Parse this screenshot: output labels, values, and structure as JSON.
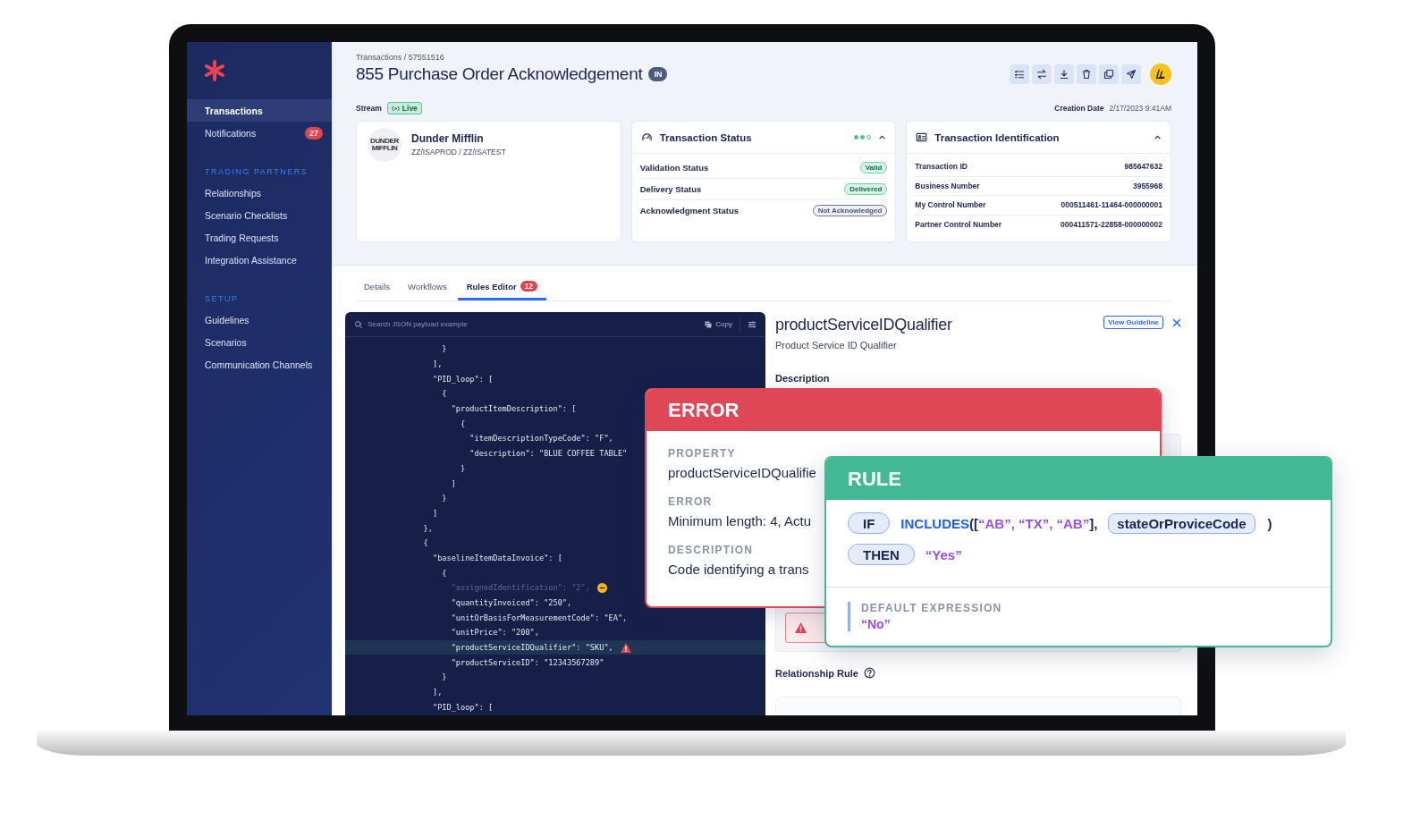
{
  "sidebar": {
    "items": [
      {
        "label": "Transactions",
        "selected": true
      },
      {
        "label": "Notifications",
        "selected": false,
        "badge": "27"
      }
    ],
    "sections": [
      {
        "title": "TRADING PARTNERS",
        "items": [
          {
            "label": "Relationships",
            "selected": false
          },
          {
            "label": "Scenario Checklists",
            "selected": false
          },
          {
            "label": "Trading Requests",
            "selected": false
          },
          {
            "label": "Integration Assistance",
            "selected": false
          }
        ]
      },
      {
        "title": "SETUP",
        "items": [
          {
            "label": "Guidelines",
            "selected": false
          },
          {
            "label": "Scenarios",
            "selected": false
          },
          {
            "label": "Communication Channels",
            "selected": false
          }
        ]
      }
    ]
  },
  "header": {
    "breadcrumb": "Transactions / 57551516",
    "title": "855 Purchase Order Acknowledgement",
    "direction_badge": "IN",
    "stream_label": "Stream",
    "stream_status": "Live",
    "creation_date_label": "Creation Date",
    "creation_date": "2/17/2023 9:41AM"
  },
  "partner_card": {
    "logo_text": "DUNDER MIFFLIN",
    "name": "Dunder Mifflin",
    "ids": "ZZ/ISAPROD / ZZ/ISATEST"
  },
  "status_card": {
    "title": "Transaction Status",
    "expanded": true,
    "progress_dots": [
      {
        "filled": true
      },
      {
        "filled": true
      },
      {
        "filled": false
      }
    ],
    "rows": [
      {
        "label": "Validation Status",
        "value": "Valid",
        "kind": "success"
      },
      {
        "label": "Delivery Status",
        "value": "Delivered",
        "kind": "success"
      },
      {
        "label": "Acknowledgment Status",
        "value": "Not Acknowledged",
        "kind": "neutral"
      }
    ]
  },
  "identification_card": {
    "title": "Transaction Identification",
    "expanded": true,
    "rows": [
      {
        "label": "Transaction ID",
        "value": "985647632"
      },
      {
        "label": "Business Number",
        "value": "3955968"
      },
      {
        "label": "My Control Number",
        "value": "000511461-11464-000000001"
      },
      {
        "label": "Partner Control Number",
        "value": "000411571-22858-000000002"
      }
    ]
  },
  "tabs": [
    {
      "label": "Details",
      "selected": false
    },
    {
      "label": "Workflows",
      "selected": false
    },
    {
      "label": "Rules Editor",
      "selected": true,
      "badge": "12"
    }
  ],
  "code_panel": {
    "search_placeholder": "Search JSON payload example",
    "copy_label": "Copy",
    "lines": [
      {
        "text": "                   }",
        "kind": "normal"
      },
      {
        "text": "                 ],",
        "kind": "normal"
      },
      {
        "text": "                 \"PID_loop\": [",
        "kind": "normal"
      },
      {
        "text": "                   {",
        "kind": "normal"
      },
      {
        "text": "                     \"productItemDescription\": [",
        "kind": "normal"
      },
      {
        "text": "                       {",
        "kind": "normal"
      },
      {
        "text": "                         \"itemDescriptionTypeCode\": \"F\",",
        "kind": "normal"
      },
      {
        "text": "                         \"description\": \"BLUE COFFEE TABLE\"",
        "kind": "normal"
      },
      {
        "text": "                       }",
        "kind": "normal"
      },
      {
        "text": "                     ]",
        "kind": "normal"
      },
      {
        "text": "                   }",
        "kind": "normal"
      },
      {
        "text": "                 ]",
        "kind": "normal"
      },
      {
        "text": "               },",
        "kind": "normal"
      },
      {
        "text": "               {",
        "kind": "normal"
      },
      {
        "text": "                 \"baselineItemDataInvoice\": [",
        "kind": "normal"
      },
      {
        "text": "                   {",
        "kind": "normal"
      },
      {
        "text": "                     \"assignedIdentification\": \"2\",",
        "kind": "removed"
      },
      {
        "text": "                     \"quantityInvoiced\": \"250\",",
        "kind": "normal"
      },
      {
        "text": "                     \"unitOrBasisForMeasurementCode\": \"EA\",",
        "kind": "normal"
      },
      {
        "text": "                     \"unitPrice\": \"200\",",
        "kind": "normal"
      },
      {
        "text": "                     \"productServiceIDQualifier\": \"SKU\",",
        "kind": "error"
      },
      {
        "text": "                     \"productServiceID\": \"12343567289\"",
        "kind": "normal"
      },
      {
        "text": "                   }",
        "kind": "normal"
      },
      {
        "text": "                 ],",
        "kind": "normal"
      },
      {
        "text": "                 \"PID_loop\": [",
        "kind": "normal"
      }
    ]
  },
  "detail_panel": {
    "title": "productServiceIDQualifier",
    "subtitle": "Product Service ID Qualifier",
    "guideline_button": "View Guideline",
    "description_label": "Description",
    "relationship_label": "Relationship Rule"
  },
  "error_card": {
    "title": "ERROR",
    "fields": [
      {
        "label": "PROPERTY",
        "value": "productServiceIDQualifie"
      },
      {
        "label": "ERROR",
        "value": "Minimum length: 4, Actu"
      },
      {
        "label": "DESCRIPTION",
        "value": "Code identifying a trans"
      }
    ]
  },
  "rule_card": {
    "title": "RULE",
    "clauses": [
      {
        "keyword": "IF",
        "tokens": [
          {
            "kind": "function",
            "text": "INCLUDES"
          },
          {
            "kind": "punct",
            "text": "(["
          },
          {
            "kind": "string",
            "text": "“AB”, “TX”, “AB”"
          },
          {
            "kind": "punct",
            "text": "],"
          },
          {
            "kind": "field",
            "text": "stateOrProviceCode"
          },
          {
            "kind": "punct",
            "text": ")"
          }
        ]
      },
      {
        "keyword": "THEN",
        "tokens": [
          {
            "kind": "string",
            "text": "“Yes”"
          }
        ]
      }
    ],
    "default_label": "DEFAULT EXPRESSION",
    "default_value": "“No”"
  }
}
